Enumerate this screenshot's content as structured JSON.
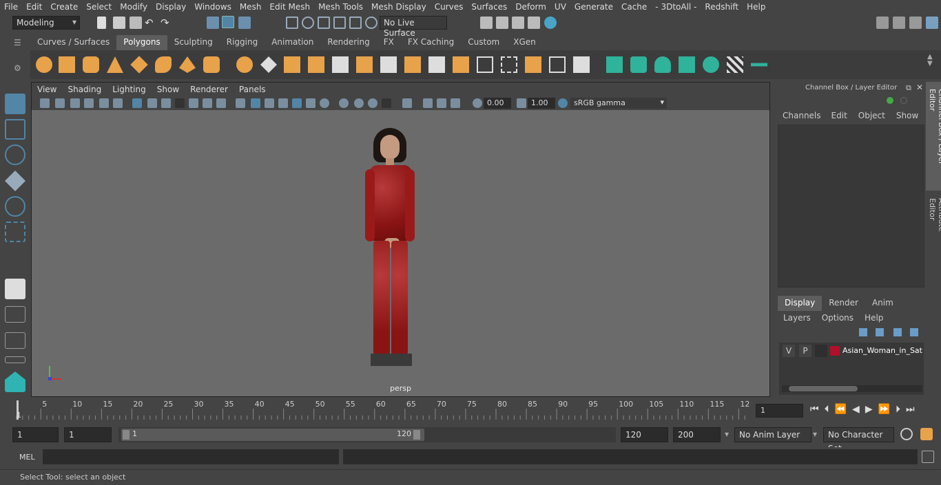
{
  "menu": [
    "File",
    "Edit",
    "Create",
    "Select",
    "Modify",
    "Display",
    "Windows",
    "Mesh",
    "Edit Mesh",
    "Mesh Tools",
    "Mesh Display",
    "Curves",
    "Surfaces",
    "Deform",
    "UV",
    "Generate",
    "Cache",
    "- 3DtoAll -",
    "Redshift",
    "Help"
  ],
  "mode": "Modeling",
  "live_surface": "No Live Surface",
  "shelf_tabs": [
    "Curves / Surfaces",
    "Polygons",
    "Sculpting",
    "Rigging",
    "Animation",
    "Rendering",
    "FX",
    "FX Caching",
    "Custom",
    "XGen"
  ],
  "active_tab": "Polygons",
  "viewport": {
    "menu": [
      "View",
      "Shading",
      "Lighting",
      "Show",
      "Renderer",
      "Panels"
    ],
    "exposure": "0.00",
    "gamma": "1.00",
    "colorspace": "sRGB gamma",
    "camera_label": "persp"
  },
  "channel_box": {
    "title": "Channel Box / Layer Editor",
    "menu": [
      "Channels",
      "Edit",
      "Object",
      "Show"
    ],
    "side_tab_1": "Channel Box / Layer Editor",
    "side_tab_2": "Attribute Editor",
    "layer_tabs": [
      "Display",
      "Render",
      "Anim"
    ],
    "layer_menu": [
      "Layers",
      "Options",
      "Help"
    ],
    "layer": {
      "v": "V",
      "p": "P",
      "name": "Asian_Woman_in_Satin",
      "color": "#b0102a"
    }
  },
  "timeline": {
    "ticks": [
      "5",
      "10",
      "15",
      "20",
      "25",
      "30",
      "35",
      "40",
      "45",
      "50",
      "55",
      "60",
      "65",
      "70",
      "75",
      "80",
      "85",
      "90",
      "95",
      "100",
      "105",
      "110",
      "115",
      "12"
    ],
    "start_label": "1",
    "current_frame": "1"
  },
  "range": {
    "start": "1",
    "playback_start": "1",
    "slider_start": "1",
    "slider_end": "120",
    "playback_end": "120",
    "end": "200",
    "anim_layer": "No Anim Layer",
    "char_set": "No Character Set"
  },
  "mel_label": "MEL",
  "help_text": "Select Tool: select an object",
  "colors": {
    "accent": "#5285a6",
    "shelf_orange": "#e8a24a",
    "shelf_teal": "#2fb39a"
  }
}
